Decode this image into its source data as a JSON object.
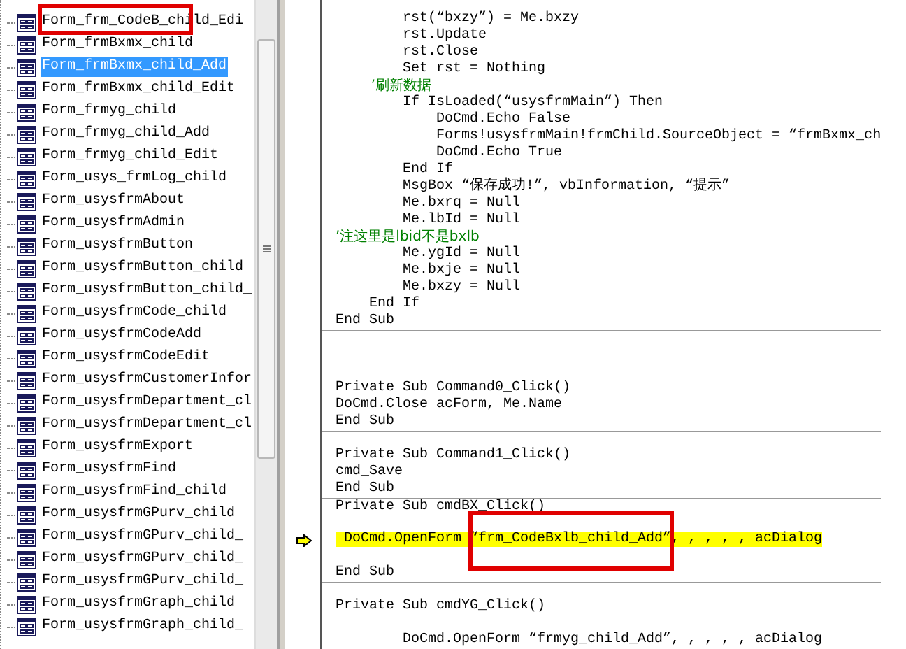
{
  "tree": {
    "items": [
      {
        "label": "Form_frm_CodeB_child_Edi",
        "selected": false
      },
      {
        "label": "Form_frmBxmx_child",
        "selected": false
      },
      {
        "label": "Form_frmBxmx_child_Add",
        "selected": true
      },
      {
        "label": "Form_frmBxmx_child_Edit",
        "selected": false
      },
      {
        "label": "Form_frmyg_child",
        "selected": false
      },
      {
        "label": "Form_frmyg_child_Add",
        "selected": false
      },
      {
        "label": "Form_frmyg_child_Edit",
        "selected": false
      },
      {
        "label": "Form_usys_frmLog_child",
        "selected": false
      },
      {
        "label": "Form_usysfrmAbout",
        "selected": false
      },
      {
        "label": "Form_usysfrmAdmin",
        "selected": false
      },
      {
        "label": "Form_usysfrmButton",
        "selected": false
      },
      {
        "label": "Form_usysfrmButton_child",
        "selected": false
      },
      {
        "label": "Form_usysfrmButton_child_",
        "selected": false
      },
      {
        "label": "Form_usysfrmCode_child",
        "selected": false
      },
      {
        "label": "Form_usysfrmCodeAdd",
        "selected": false
      },
      {
        "label": "Form_usysfrmCodeEdit",
        "selected": false
      },
      {
        "label": "Form_usysfrmCustomerInfor",
        "selected": false
      },
      {
        "label": "Form_usysfrmDepartment_cl",
        "selected": false
      },
      {
        "label": "Form_usysfrmDepartment_cl",
        "selected": false
      },
      {
        "label": "Form_usysfrmExport",
        "selected": false
      },
      {
        "label": "Form_usysfrmFind",
        "selected": false
      },
      {
        "label": "Form_usysfrmFind_child",
        "selected": false
      },
      {
        "label": "Form_usysfrmGPurv_child",
        "selected": false
      },
      {
        "label": "Form_usysfrmGPurv_child_",
        "selected": false
      },
      {
        "label": "Form_usysfrmGPurv_child_",
        "selected": false
      },
      {
        "label": "Form_usysfrmGPurv_child_",
        "selected": false
      },
      {
        "label": "Form_usysfrmGraph_child",
        "selected": false
      },
      {
        "label": "Form_usysfrmGraph_child_",
        "selected": false
      }
    ]
  },
  "code": {
    "lines": [
      {
        "kind": "code",
        "text": "        rst(“bxzy”) = Me.bxzy"
      },
      {
        "kind": "code",
        "text": "        rst.Update"
      },
      {
        "kind": "code",
        "text": "        rst.Close"
      },
      {
        "kind": "code",
        "text": "        Set rst = Nothing"
      },
      {
        "kind": "comment",
        "text": "        ’刷新数据"
      },
      {
        "kind": "code",
        "text": "        If IsLoaded(“usysfrmMain”) Then"
      },
      {
        "kind": "code",
        "text": "            DoCmd.Echo False"
      },
      {
        "kind": "code",
        "text": "            Forms!usysfrmMain!frmChild.SourceObject = “frmBxmx_ch"
      },
      {
        "kind": "code",
        "text": "            DoCmd.Echo True"
      },
      {
        "kind": "code",
        "text": "        End If"
      },
      {
        "kind": "code",
        "text": "        MsgBox “保存成功!”, vbInformation, “提示”"
      },
      {
        "kind": "code",
        "text": "        Me.bxrq = Null"
      },
      {
        "kind": "code",
        "text": "        Me.lbId = Null"
      },
      {
        "kind": "comment",
        "text": "’注这里是lbid不是bxlb"
      },
      {
        "kind": "code",
        "text": "        Me.ygId = Null"
      },
      {
        "kind": "code",
        "text": "        Me.bxje = Null"
      },
      {
        "kind": "code",
        "text": "        Me.bxzy = Null"
      },
      {
        "kind": "code",
        "text": "    End If"
      },
      {
        "kind": "code",
        "text": "End Sub"
      },
      {
        "kind": "blank",
        "separator_before": true
      },
      {
        "kind": "blank"
      },
      {
        "kind": "blank"
      },
      {
        "kind": "code",
        "text": "Private Sub Command0_Click()"
      },
      {
        "kind": "code",
        "text": "DoCmd.Close acForm, Me.Name"
      },
      {
        "kind": "code",
        "text": "End Sub"
      },
      {
        "kind": "blank",
        "separator_before": true
      },
      {
        "kind": "code",
        "text": "Private Sub Command1_Click()"
      },
      {
        "kind": "code",
        "text": "cmd_Save"
      },
      {
        "kind": "code",
        "text": "End Sub"
      },
      {
        "kind": "code",
        "text": "Private Sub cmdBX_Click()",
        "separator_before": true
      },
      {
        "kind": "blank"
      },
      {
        "kind": "current",
        "text": " DoCmd.OpenForm “frm_CodeBxlb_child_Add”, , , , , acDialog"
      },
      {
        "kind": "blank"
      },
      {
        "kind": "code",
        "text": "End Sub"
      },
      {
        "kind": "blank",
        "separator_before": true
      },
      {
        "kind": "code",
        "text": "Private Sub cmdYG_Click()"
      },
      {
        "kind": "blank"
      },
      {
        "kind": "code",
        "text": "        DoCmd.OpenForm “frmyg_child_Add”, , , , , acDialog"
      }
    ]
  }
}
